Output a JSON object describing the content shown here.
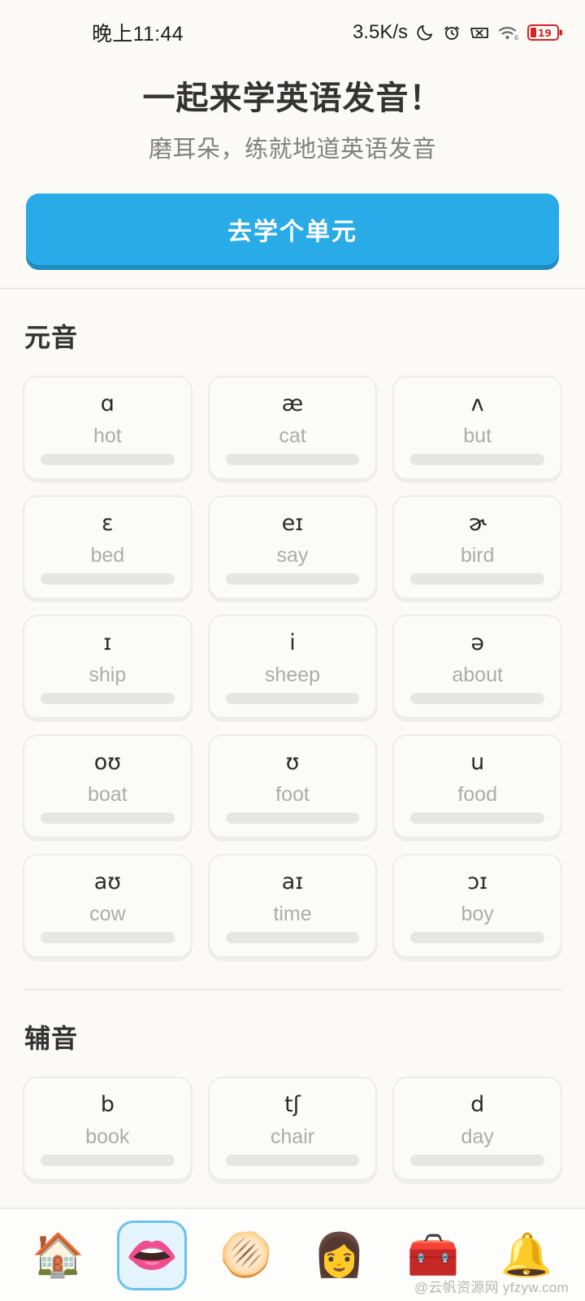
{
  "status_bar": {
    "time": "晚上11:44",
    "network_speed": "3.5K/s",
    "battery_percent": "19",
    "icons": [
      "moon-icon",
      "alarm-icon",
      "signal-off-icon",
      "wifi-icon",
      "battery-icon"
    ]
  },
  "header": {
    "title": "一起来学英语发音！",
    "subtitle": "磨耳朵，练就地道英语发音",
    "cta_label": "去学个单元",
    "cta_color": "#29abe8"
  },
  "sections": [
    {
      "title": "元音",
      "cards": [
        {
          "ipa": "ɑ",
          "word": "hot",
          "progress": 0
        },
        {
          "ipa": "æ",
          "word": "cat",
          "progress": 0
        },
        {
          "ipa": "ʌ",
          "word": "but",
          "progress": 0
        },
        {
          "ipa": "ɛ",
          "word": "bed",
          "progress": 0
        },
        {
          "ipa": "eɪ",
          "word": "say",
          "progress": 0
        },
        {
          "ipa": "ɚ",
          "word": "bird",
          "progress": 0
        },
        {
          "ipa": "ɪ",
          "word": "ship",
          "progress": 0
        },
        {
          "ipa": "i",
          "word": "sheep",
          "progress": 0
        },
        {
          "ipa": "ə",
          "word": "about",
          "progress": 0
        },
        {
          "ipa": "oʊ",
          "word": "boat",
          "progress": 0
        },
        {
          "ipa": "ʊ",
          "word": "foot",
          "progress": 0
        },
        {
          "ipa": "u",
          "word": "food",
          "progress": 0
        },
        {
          "ipa": "aʊ",
          "word": "cow",
          "progress": 0
        },
        {
          "ipa": "aɪ",
          "word": "time",
          "progress": 0
        },
        {
          "ipa": "ɔɪ",
          "word": "boy",
          "progress": 0
        }
      ]
    },
    {
      "title": "辅音",
      "cards": [
        {
          "ipa": "b",
          "word": "book",
          "progress": 0
        },
        {
          "ipa": "tʃ",
          "word": "chair",
          "progress": 0
        },
        {
          "ipa": "d",
          "word": "day",
          "progress": 0
        }
      ]
    }
  ],
  "bottom_nav": {
    "active_index": 1,
    "items": [
      {
        "icon": "house-emoji",
        "glyph": "🏠"
      },
      {
        "icon": "mouth-emoji",
        "glyph": "👄"
      },
      {
        "icon": "tongue-shield-emoji",
        "glyph": "🫓"
      },
      {
        "icon": "woman-emoji",
        "glyph": "👩"
      },
      {
        "icon": "treasure-chest-emoji",
        "glyph": "🧰"
      },
      {
        "icon": "bell-emoji",
        "glyph": "🔔"
      }
    ]
  },
  "watermark": "@云帆资源网 yfzyw.com"
}
